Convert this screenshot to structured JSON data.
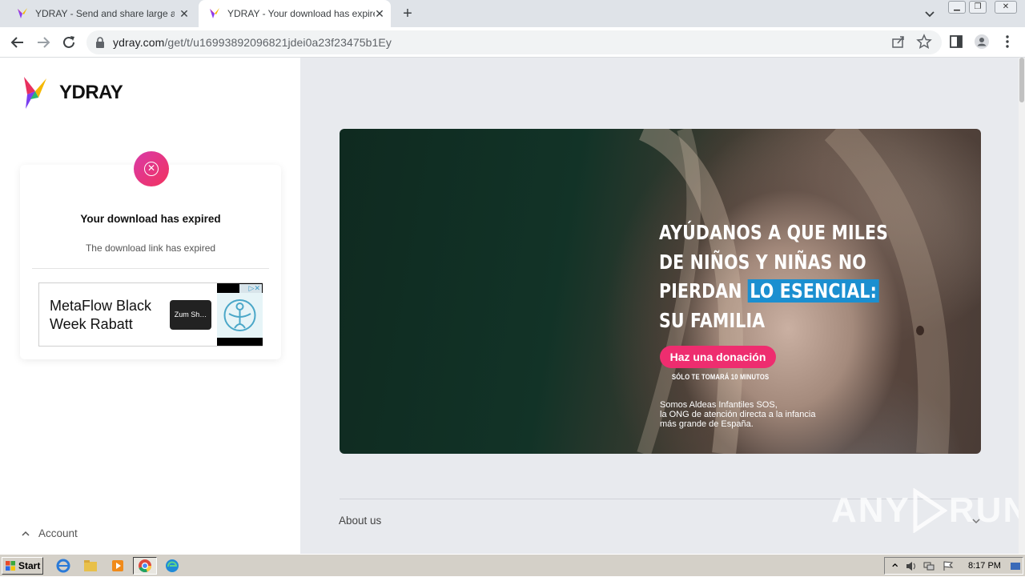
{
  "browser": {
    "tabs": [
      {
        "title": "YDRAY - Send and share large and b",
        "active": false
      },
      {
        "title": "YDRAY - Your download has expired",
        "active": true
      }
    ],
    "url_host": "ydray.com",
    "url_path": "/get/t/u16993892096821jdei0a23f23475b1Ey"
  },
  "sidebar": {
    "brand": "YDRAY",
    "card": {
      "title": "Your download has expired",
      "subtitle": "The download link has expired"
    },
    "ad": {
      "text": "MetaFlow Black Week Rabatt",
      "button": "Zum Sh…"
    },
    "account_label": "Account"
  },
  "banner": {
    "line1": "AYÚDANOS A QUE MILES",
    "line2": "DE NIÑOS Y NIÑAS NO",
    "line3_a": "PIERDAN",
    "line3_b": "LO ESENCIAL:",
    "line4": "SU FAMILIA",
    "button": "Haz una donación",
    "button_sub": "SÓLO TE TOMARÁ 10 MINUTOS",
    "org_line1": "Somos Aldeas Infantiles SOS,",
    "org_line2": "la ONG de atención directa a la infancia",
    "org_line3": "más grande de España."
  },
  "footer": {
    "about": "About us"
  },
  "watermark": {
    "left": "ANY",
    "right": "RUN"
  },
  "taskbar": {
    "start": "Start",
    "clock": "8:17 PM"
  },
  "colors": {
    "accent_pink": "#ee2d6f",
    "highlight_blue": "#1b8fd0",
    "error_gradient_start": "#d93aa8",
    "error_gradient_end": "#f2335e"
  }
}
